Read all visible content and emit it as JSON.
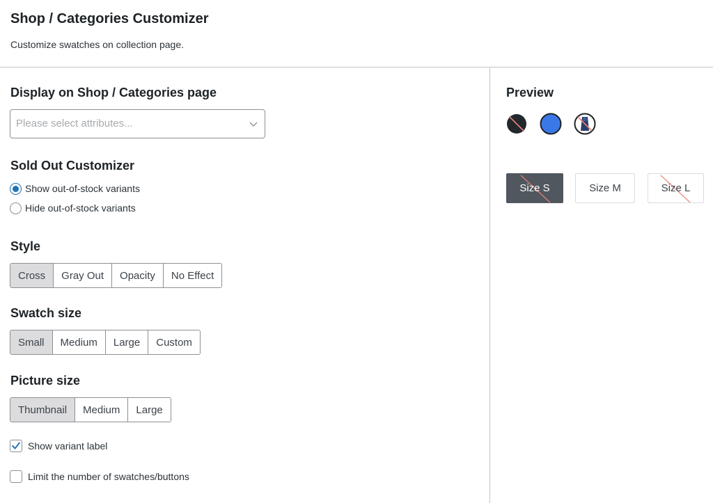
{
  "header": {
    "title": "Shop / Categories Customizer",
    "subtitle": "Customize swatches on collection page."
  },
  "display": {
    "title": "Display on Shop / Categories page",
    "select_placeholder": "Please select attributes..."
  },
  "sold_out": {
    "title": "Sold Out Customizer",
    "options": [
      {
        "label": "Show out-of-stock variants",
        "checked": true
      },
      {
        "label": "Hide out-of-stock variants",
        "checked": false
      }
    ]
  },
  "style": {
    "title": "Style",
    "options": [
      "Cross",
      "Gray Out",
      "Opacity",
      "No Effect"
    ],
    "selected": "Cross"
  },
  "swatch_size": {
    "title": "Swatch size",
    "options": [
      "Small",
      "Medium",
      "Large",
      "Custom"
    ],
    "selected": "Small"
  },
  "picture_size": {
    "title": "Picture size",
    "options": [
      "Thumbnail",
      "Medium",
      "Large"
    ],
    "selected": "Thumbnail"
  },
  "checkboxes": [
    {
      "label": "Show variant label",
      "checked": true
    },
    {
      "label": "Limit the number of swatches/buttons",
      "checked": false
    }
  ],
  "preview": {
    "title": "Preview",
    "swatches": [
      {
        "color": "#23282d",
        "crossed": true,
        "selected": false
      },
      {
        "color": "#3b78e7",
        "crossed": false,
        "selected": true
      },
      {
        "color": "#2a3e6c",
        "crossed": true,
        "selected": false
      }
    ],
    "sizes": [
      {
        "label": "Size S",
        "selected": true,
        "crossed": true
      },
      {
        "label": "Size M",
        "selected": false,
        "crossed": false
      },
      {
        "label": "Size L",
        "selected": false,
        "crossed": true
      }
    ]
  },
  "colors": {
    "accent": "#2271b1",
    "cross": "#e8827a",
    "segment_active": "#dcdcde",
    "size_selected": "#50575e"
  }
}
